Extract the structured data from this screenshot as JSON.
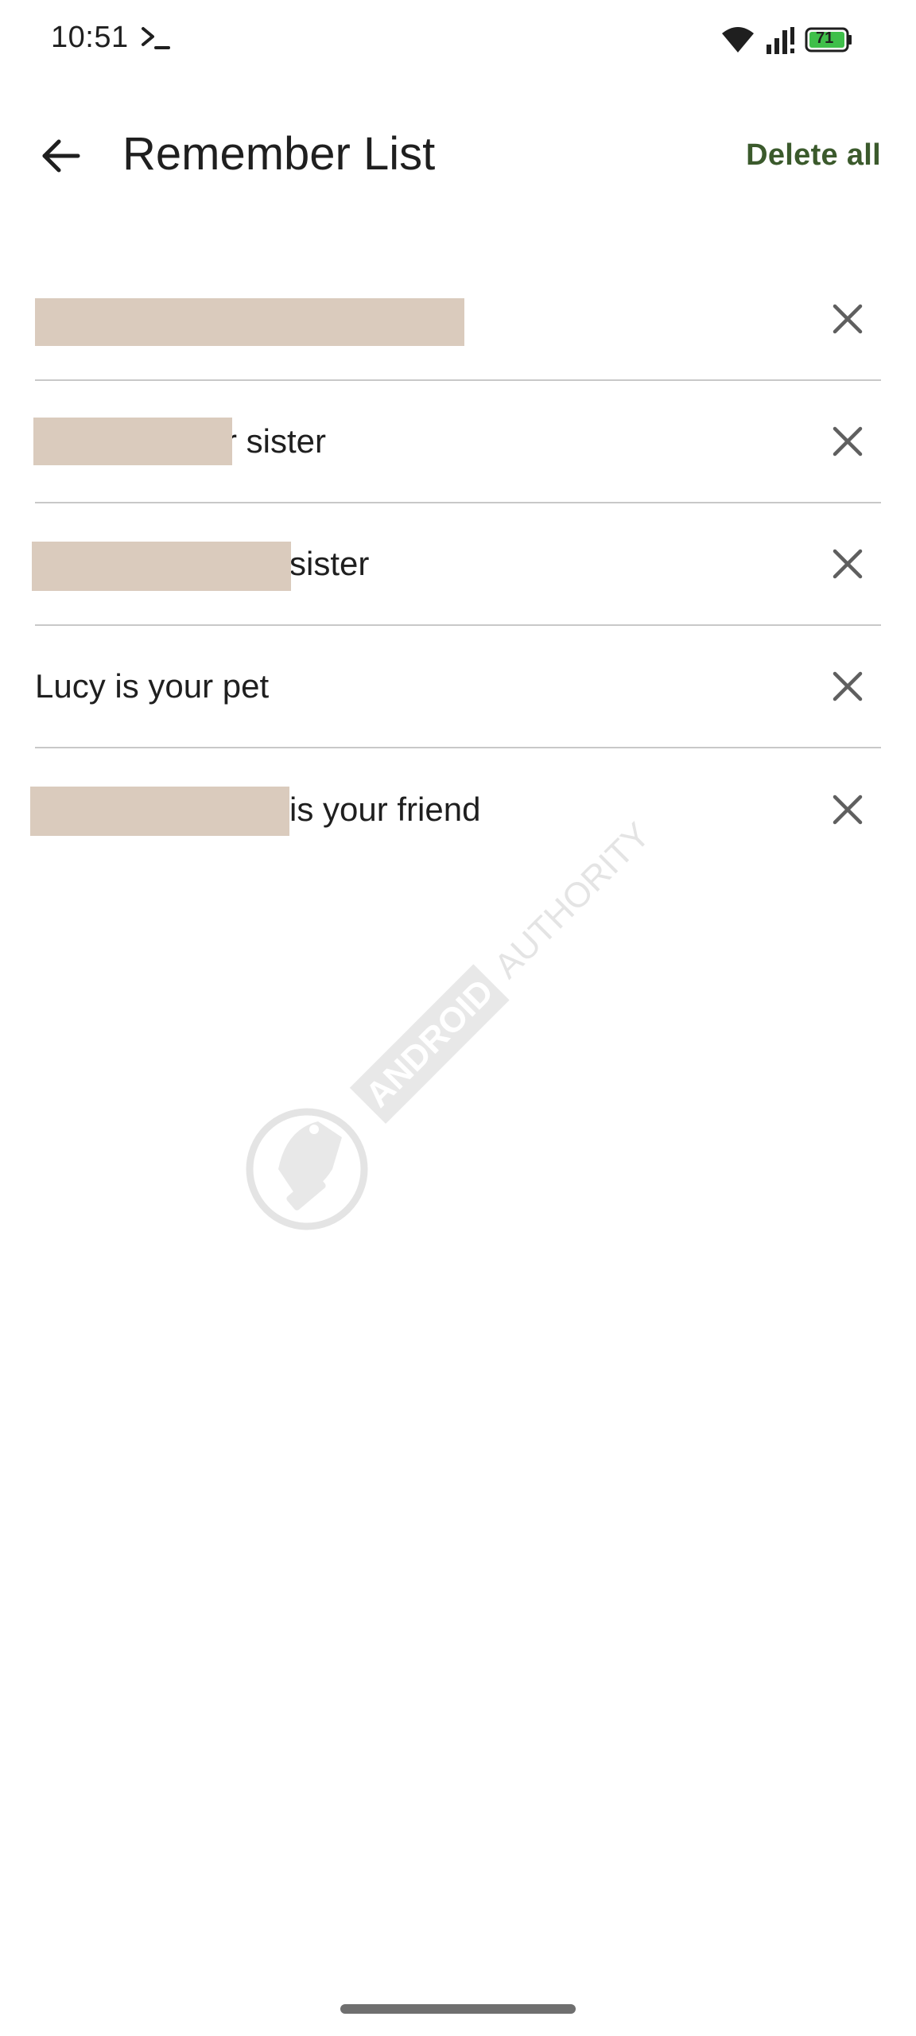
{
  "status_bar": {
    "time": "10:51",
    "battery_level": "71"
  },
  "app_bar": {
    "title": "Remember List",
    "delete_all_label": "Delete all"
  },
  "items": [
    {
      "visible_text": ""
    },
    {
      "visible_text": "r sister"
    },
    {
      "visible_text": "sister"
    },
    {
      "visible_text": "Lucy is your pet"
    },
    {
      "visible_text": "is your friend"
    }
  ],
  "watermark": {
    "text": "ANDROID AUTHORITY"
  },
  "colors": {
    "accent": "#3b5a2c",
    "redaction": "#dacbbd",
    "divider": "#c8c8c8",
    "text": "#1f1f1f"
  }
}
